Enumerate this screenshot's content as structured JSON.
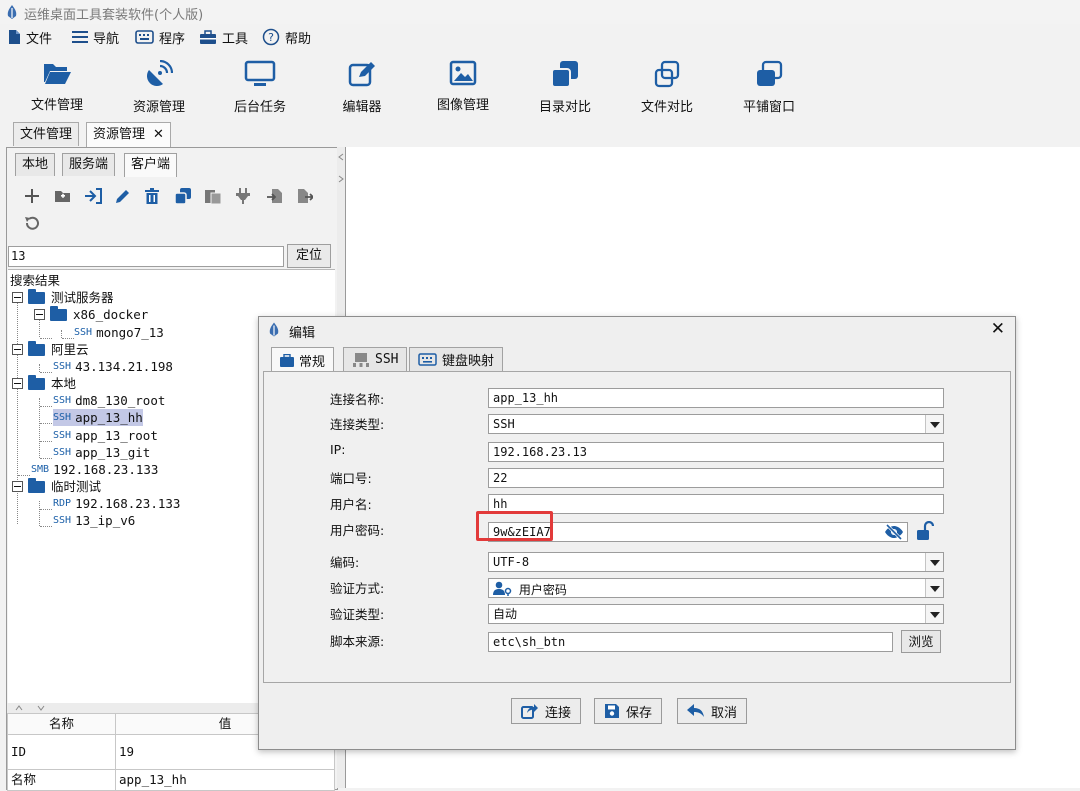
{
  "app": {
    "title": "运维桌面工具套装软件(个人版)"
  },
  "menu": {
    "items": [
      "文件",
      "导航",
      "程序",
      "工具",
      "帮助"
    ]
  },
  "toolbar": {
    "items": [
      "文件管理",
      "资源管理",
      "后台任务",
      "编辑器",
      "图像管理",
      "目录对比",
      "文件对比",
      "平铺窗口"
    ]
  },
  "doc_tabs": {
    "tab1": "文件管理",
    "tab2": "资源管理",
    "close": "✕"
  },
  "left": {
    "tabs": [
      "本地",
      "服务端",
      "客户端"
    ],
    "active_tab": "客户端",
    "search_value": "13",
    "locate_label": "定位",
    "tree_root": "搜索结果",
    "tree": {
      "g1": "测试服务器",
      "g1_sub": "x86_docker",
      "g1_leaf_tag": "SSH",
      "g1_leaf": "mongo7_13",
      "g2": "阿里云",
      "g2_leaf_tag": "SSH",
      "g2_leaf": "43.134.21.198",
      "g3": "本地",
      "g3_l1_tag": "SSH",
      "g3_l1": "dm8_130_root",
      "g3_l2_tag": "SSH",
      "g3_l2": "app_13_hh",
      "g3_l3_tag": "SSH",
      "g3_l3": "app_13_root",
      "g3_l4_tag": "SSH",
      "g3_l4": "app_13_git",
      "smb_tag": "SMB",
      "smb": "192.168.23.133",
      "g4": "临时测试",
      "g4_l1_tag": "RDP",
      "g4_l1": "192.168.23.133",
      "g4_l2_tag": "SSH",
      "g4_l2": "13_ip_v6"
    },
    "props": {
      "col_name": "名称",
      "col_value": "值",
      "row1_name": "ID",
      "row1_value": "19",
      "row2_name": "名称",
      "row2_value": "app_13_hh"
    }
  },
  "dialog": {
    "title": "编辑",
    "close": "✕",
    "tabs": [
      "常规",
      "SSH",
      "键盘映射"
    ],
    "labels": {
      "conn_name": "连接名称:",
      "conn_type": "连接类型:",
      "ip": "IP:",
      "port": "端口号:",
      "user": "用户名:",
      "password": "用户密码:",
      "encoding": "编码:",
      "auth_method": "验证方式:",
      "auth_type": "验证类型:",
      "script_source": "脚本来源:"
    },
    "values": {
      "conn_name": "app_13_hh",
      "conn_type": "SSH",
      "ip": "192.168.23.13",
      "port": "22",
      "user": "hh",
      "password": "9w&zEIA7",
      "encoding": "UTF-8",
      "auth_method": "用户密码",
      "auth_type": "自动",
      "script_source": "etc\\sh_btn"
    },
    "browse_label": "浏览",
    "buttons": {
      "connect": "连接",
      "save": "保存",
      "cancel": "取消"
    }
  },
  "colors": {
    "accent": "#1e5ea5",
    "highlight_border": "#e23a3a",
    "selection": "#c3c8e6"
  }
}
